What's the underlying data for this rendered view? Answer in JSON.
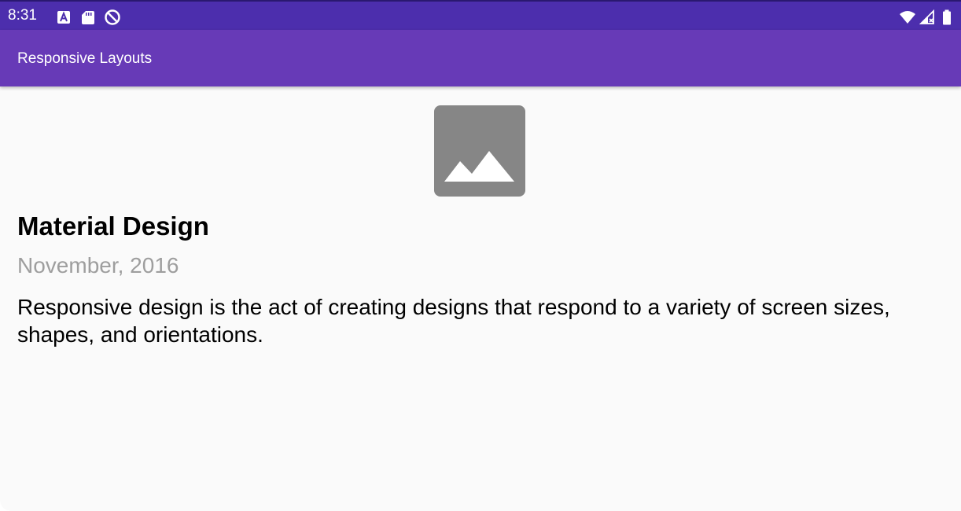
{
  "status_bar": {
    "time": "8:31",
    "left_icons": [
      "app-a-icon",
      "sd-card-icon",
      "do-not-disturb-icon"
    ],
    "right_icons": [
      "wifi-icon",
      "cell-signal-no-data-icon",
      "battery-icon"
    ]
  },
  "app_bar": {
    "title": "Responsive Layouts"
  },
  "content": {
    "image": "image-placeholder-icon",
    "headline": "Material Design",
    "date": "November, 2016",
    "body": "Responsive design is the act of creating designs that respond to a variety of screen sizes, shapes, and orientations."
  },
  "colors": {
    "status_bar": "#4c2ead",
    "app_bar": "#673ab7",
    "background": "#fafafa",
    "placeholder": "#868686",
    "date_text": "#9e9e9e"
  }
}
